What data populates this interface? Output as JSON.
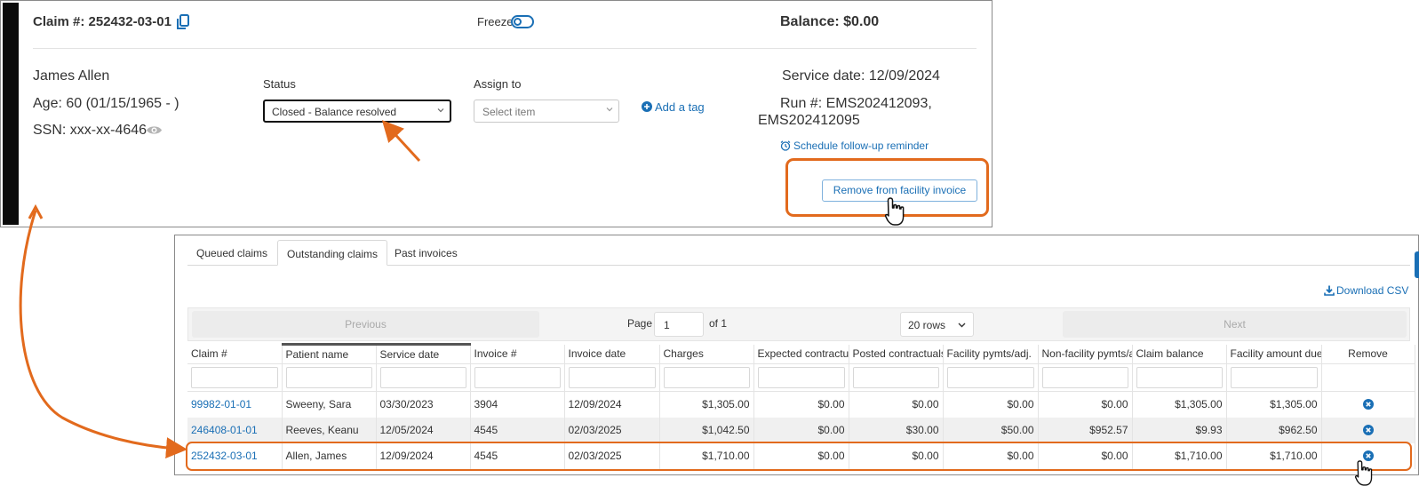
{
  "claim": {
    "title": "Claim #: 252432-03-01",
    "freeze_label": "Freeze",
    "balance": "Balance: $0.00",
    "patient_name": "James Allen",
    "age": "Age: 60  (01/15/1965 - )",
    "ssn": "SSN: xxx-xx-4646",
    "status_label": "Status",
    "status_value": "Closed - Balance resolved",
    "assign_label": "Assign to",
    "assign_placeholder": "Select item",
    "add_tag": "Add a tag",
    "service_date": "Service date: 12/09/2024",
    "run_line1": "Run #: EMS202412093,",
    "run_line2": "EMS202412095",
    "followup": "Schedule follow-up reminder",
    "remove_button": "Remove from facility invoice"
  },
  "invoice": {
    "tabs": [
      {
        "label": "Queued claims",
        "active": false
      },
      {
        "label": "Outstanding claims",
        "active": true
      },
      {
        "label": "Past invoices",
        "active": false
      }
    ],
    "download_csv": "Download CSV",
    "pager": {
      "previous": "Previous",
      "page_label": "Page",
      "page_value": "1",
      "of_label": "of 1",
      "rows": "20 rows",
      "next": "Next"
    },
    "columns": [
      "Claim #",
      "Patient name",
      "Service date",
      "Invoice #",
      "Invoice date",
      "Charges",
      "Expected contractu",
      "Posted contractuals",
      "Facility pymts/adj.",
      "Non-facility pymts/a",
      "Claim balance",
      "Facility amount due",
      "Remove"
    ],
    "rows": [
      [
        "99982-01-01",
        "Sweeny, Sara",
        "03/30/2023",
        "3904",
        "12/09/2024",
        "$1,305.00",
        "$0.00",
        "$0.00",
        "$0.00",
        "$0.00",
        "$1,305.00",
        "$1,305.00"
      ],
      [
        "246408-01-01",
        "Reeves, Keanu",
        "12/05/2024",
        "4545",
        "02/03/2025",
        "$1,042.50",
        "$0.00",
        "$30.00",
        "$50.00",
        "$952.57",
        "$9.93",
        "$962.50"
      ],
      [
        "252432-03-01",
        "Allen, James",
        "12/09/2024",
        "4545",
        "02/03/2025",
        "$1,710.00",
        "$0.00",
        "$0.00",
        "$0.00",
        "$0.00",
        "$1,710.00",
        "$1,710.00"
      ]
    ]
  },
  "colors": {
    "accent": "#1a6fb5",
    "highlight": "#e26a1d"
  }
}
